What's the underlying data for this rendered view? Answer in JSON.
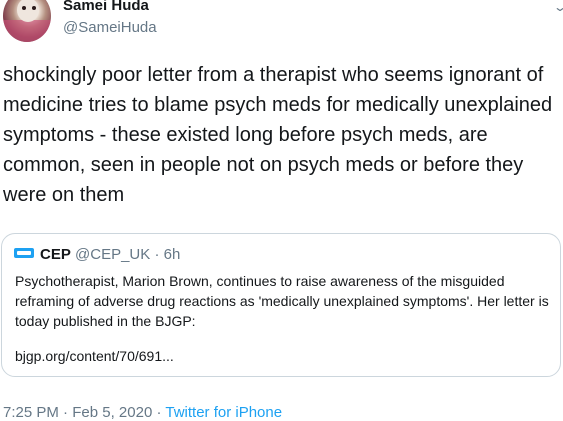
{
  "author": {
    "display_name": "Samei Huda",
    "handle": "@SameiHuda"
  },
  "tweet": {
    "text": "shockingly poor letter from a therapist who seems ignorant of medicine tries to blame psych meds for medically unexplained symptoms - these existed long before psych meds, are common, seen in people not on psych meds or before they were on them"
  },
  "quoted_tweet": {
    "display_name": "CEP",
    "handle": "@CEP_UK",
    "separator": "·",
    "time_ago": "6h",
    "text": "Psychotherapist, Marion Brown, continues to raise awareness of the misguided reframing of adverse drug reactions as 'medically unexplained symptoms'. Her letter is today published in the BJGP:",
    "link": "bjgp.org/content/70/691..."
  },
  "footer": {
    "time": "7:25 PM",
    "separator": "·",
    "date": "Feb 5, 2020",
    "source": "Twitter for iPhone"
  },
  "icons": {
    "more": "chevron-down-icon",
    "quote_logo": "cep-logo-icon"
  },
  "colors": {
    "text": "#14171a",
    "secondary": "#657786",
    "link": "#1da1f2",
    "border": "#ccd6dd"
  }
}
